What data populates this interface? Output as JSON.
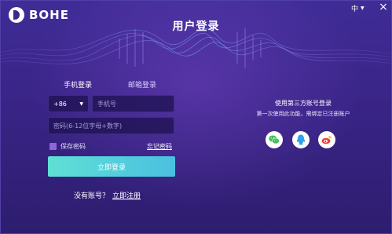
{
  "app": {
    "logo_text": "BOHE",
    "title": "用户登录",
    "language": "中"
  },
  "tabs": [
    {
      "label": "手机登录",
      "active": true
    },
    {
      "label": "邮箱登录",
      "active": false
    }
  ],
  "form": {
    "country_code": "+86",
    "phone_placeholder": "手机号",
    "password_placeholder": "密码(6-12位字母+数字)",
    "remember_label": "保存密码",
    "remember_checked": true,
    "forgot_label": "忘记密码",
    "login_button": "立即登录",
    "no_account": "没有账号？",
    "register_link": "立即注册"
  },
  "third_party": {
    "title": "使用第三方账号登录",
    "subtitle": "第一次使用此功能，需绑定已注册账户",
    "providers": [
      "wechat-icon",
      "qq-icon",
      "weibo-icon"
    ]
  },
  "colors": {
    "accent_gradient_start": "#5fe0d5",
    "accent_gradient_end": "#4ac0e0",
    "wechat": "#3fbf5a",
    "qq": "#2fa2e8",
    "weibo": "#e8413b"
  }
}
